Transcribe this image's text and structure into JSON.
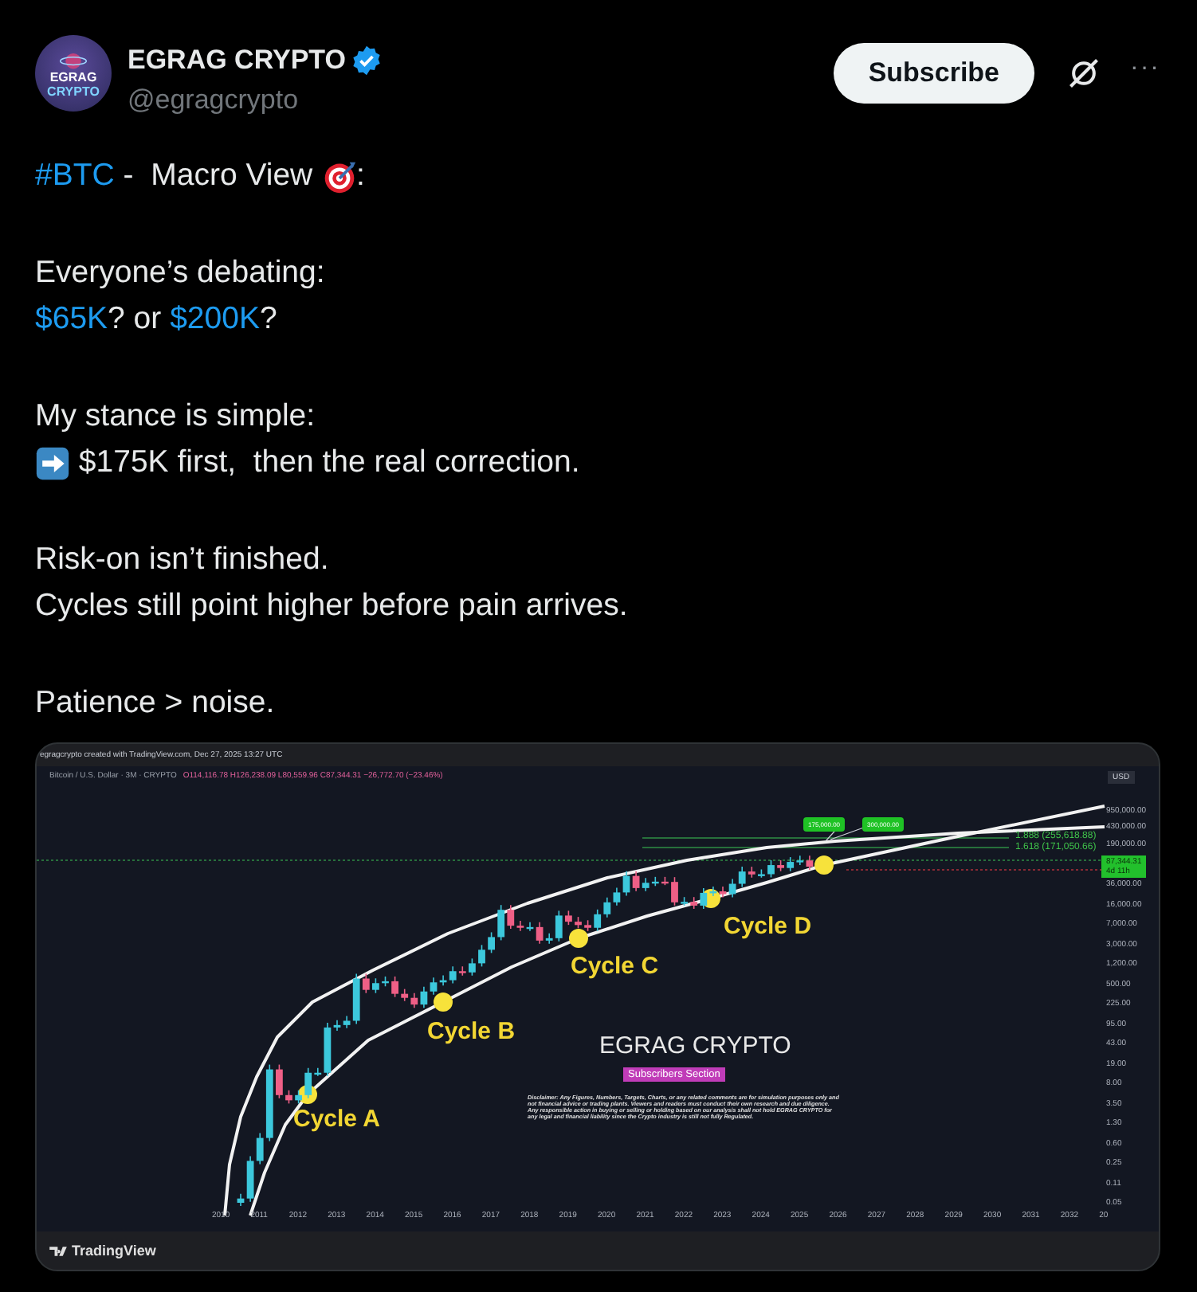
{
  "post": {
    "author": {
      "name": "EGRAG CRYPTO",
      "handle": "@egragcrypto",
      "verified": true,
      "avatar_text": [
        "EGRAG",
        "CRYPTO"
      ]
    },
    "subscribe": "Subscribe",
    "more": "···",
    "paragraphs": [
      [
        [
          {
            "kind": "link",
            "text": "#BTC"
          },
          {
            "kind": "text",
            "text": " -  Macro View "
          },
          {
            "kind": "target"
          },
          {
            "kind": "text",
            "text": ":"
          }
        ]
      ],
      [
        [
          {
            "kind": "text",
            "text": "Everyone’s debating:"
          }
        ],
        [
          {
            "kind": "link",
            "text": "$65K"
          },
          {
            "kind": "text",
            "text": "? or "
          },
          {
            "kind": "link",
            "text": "$200K"
          },
          {
            "kind": "text",
            "text": "?"
          }
        ]
      ],
      [
        [
          {
            "kind": "text",
            "text": "My stance is simple:"
          }
        ],
        [
          {
            "kind": "arrow"
          },
          {
            "kind": "text",
            "text": " $175K first,  then the real correction."
          }
        ]
      ],
      [
        [
          {
            "kind": "text",
            "text": "Risk-on isn’t finished."
          }
        ],
        [
          {
            "kind": "text",
            "text": "Cycles still point higher before pain arrives."
          }
        ]
      ],
      [
        [
          {
            "kind": "text",
            "text": "Patience > noise."
          }
        ]
      ]
    ]
  },
  "chart_image": {
    "header": "egragcrypto created with TradingView.com, Dec 27, 2025 13:27 UTC",
    "symbol": "Bitcoin / U.S. Dollar · 3M · CRYPTO",
    "ohlc": "O114,116.78 H126,238.09 L80,559.96 C87,344.31 −26,772.70 (−23.46%)",
    "currency": "USD",
    "price_axis": [
      "950,000.00",
      "430,000.00",
      "190,000.00",
      "36,000.00",
      "16,000.00",
      "7,000.00",
      "3,000.00",
      "1,200.00",
      "500.00",
      "225.00",
      "95.00",
      "43.00",
      "19.00",
      "8.00",
      "3.50",
      "1.30",
      "0.60",
      "0.25",
      "0.11",
      "0.05"
    ],
    "current_price": "87,344.31",
    "countdown": "4d 11h",
    "year_axis": [
      "2010",
      "2011",
      "2012",
      "2013",
      "2014",
      "2015",
      "2016",
      "2017",
      "2018",
      "2019",
      "2020",
      "2021",
      "2022",
      "2023",
      "2024",
      "2025",
      "2026",
      "2027",
      "2028",
      "2029",
      "2030",
      "2031",
      "2032",
      "20"
    ],
    "fib_levels": [
      "1.888 (255,618.88)",
      "1.618 (171,050.66)"
    ],
    "target_tags": [
      "175,000.00",
      "300,000.00"
    ],
    "cycles": [
      "Cycle A",
      "Cycle B",
      "Cycle C",
      "Cycle D"
    ],
    "watermark": "EGRAG CRYPTO",
    "section_tag": "Subscribers Section",
    "disclaimer": "Disclaimer: Any Figures, Numbers, Targets, Charts, or any related comments are for simulation purposes only and not financial advice or trading plants. Viewers and readers must conduct their own research and due diligence. Any responsible action in buying or selling or holding based on our analysis shall not hold EGRAG CRYPTO for any legal and financial liability since the Crypto industry is still not fully Regulated.",
    "brand": "TradingView"
  }
}
